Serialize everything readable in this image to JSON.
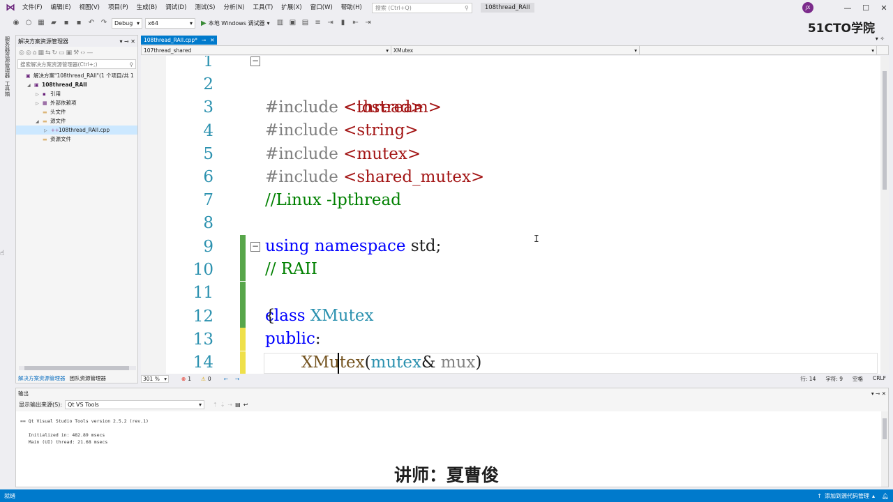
{
  "menubar": {
    "items": [
      "文件(F)",
      "编辑(E)",
      "视图(V)",
      "项目(P)",
      "生成(B)",
      "调试(D)",
      "测试(S)",
      "分析(N)",
      "工具(T)",
      "扩展(X)",
      "窗口(W)",
      "帮助(H)"
    ],
    "search_placeholder": "搜索 (Ctrl+Q)",
    "doc_title": "108thread_RAII",
    "avatar_initials": "JX",
    "minimize": "—",
    "maximize": "☐",
    "close": "✕"
  },
  "toolbar": {
    "config": "Debug",
    "platform": "x64",
    "run_label": "本地 Windows 调试器",
    "brand": "51CTO学院"
  },
  "left_strip": {
    "tab1": "服务器资源管理器",
    "tab2": "工具箱"
  },
  "solution_explorer": {
    "title": "解决方案资源管理器",
    "search_placeholder": "搜索解决方案资源管理器(Ctrl+;)",
    "tree": [
      {
        "label": "解决方案\"108thread_RAII\"(1 个项目/共 1",
        "indent": 0,
        "arrow": "",
        "icon": "solution-icon",
        "glyph": "▣"
      },
      {
        "label": "108thread_RAII",
        "indent": 1,
        "arrow": "◢",
        "icon": "project-icon",
        "glyph": "▣",
        "bold": true
      },
      {
        "label": "引用",
        "indent": 2,
        "arrow": "▷",
        "icon": "references-icon",
        "glyph": "▪"
      },
      {
        "label": "外部依赖项",
        "indent": 2,
        "arrow": "▷",
        "icon": "external-deps-icon",
        "glyph": "▦"
      },
      {
        "label": "头文件",
        "indent": 2,
        "arrow": "",
        "icon": "folder-icon",
        "glyph": "▬"
      },
      {
        "label": "源文件",
        "indent": 2,
        "arrow": "◢",
        "icon": "folder-icon",
        "glyph": "▬"
      },
      {
        "label": "108thread_RAII.cpp",
        "indent": 3,
        "arrow": "▷",
        "icon": "cpp-file-icon",
        "glyph": "++",
        "selected": true
      },
      {
        "label": "资源文件",
        "indent": 2,
        "arrow": "",
        "icon": "folder-icon",
        "glyph": "▬"
      }
    ],
    "tab_solution": "解决方案资源管理器",
    "tab_team": "团队资源管理器"
  },
  "editor": {
    "file_tab": "108thread_RAII.cpp*",
    "pin_glyph": "⊸",
    "close_glyph": "✕",
    "nav_project": "107thread_shared",
    "nav_scope": "XMutex",
    "nav_member": "",
    "lines": [
      {
        "n": "1"
      },
      {
        "n": "2"
      },
      {
        "n": "3"
      },
      {
        "n": "4"
      },
      {
        "n": "5"
      },
      {
        "n": "6"
      },
      {
        "n": "7"
      },
      {
        "n": "8"
      },
      {
        "n": "9"
      },
      {
        "n": "10"
      },
      {
        "n": "11"
      },
      {
        "n": "12"
      },
      {
        "n": "13"
      },
      {
        "n": "14"
      }
    ],
    "tokens": {
      "l1a": "#include ",
      "l1b": "<thread>",
      "l2a": "#include ",
      "l2b": "<iostream>",
      "l3a": "#include ",
      "l3b": "<string>",
      "l4a": "#include ",
      "l4b": "<mutex>",
      "l5a": "#include ",
      "l5b": "<shared_mutex>",
      "l6": "//Linux -lpthread",
      "l7a": "using",
      "l7b": " namespace",
      "l7c": " std;",
      "l8": "// RAII",
      "l9a": "class",
      "l9b": " XMutex",
      "l10": "{",
      "l11a": "public",
      "l11b": ":",
      "l12a": "XMutex",
      "l12b": "(",
      "l12c": "mutex",
      "l12d": "& ",
      "l12e": "mux",
      "l12f": ")",
      "l13": "{"
    },
    "change_colors": {
      "saved": "#57a64a",
      "unsaved": "#efe04a"
    }
  },
  "editor_status": {
    "zoom": "301 %",
    "errors": "1",
    "warnings": "0",
    "line": "行: 14",
    "col": "字符: 9",
    "spaces": "空格",
    "eol": "CRLF"
  },
  "output": {
    "title": "输出",
    "source_label": "显示输出来源(S):",
    "source_value": "Qt VS Tools",
    "lines": [
      "== Qt Visual Studio Tools version 2.5.2 (rev.1)",
      "",
      "   Initialized in: 482.89 msecs",
      "   Main (UI) thread: 21.68 msecs"
    ]
  },
  "caption": "讲师：夏曹俊",
  "statusbar": {
    "ready": "就绪",
    "source_control": "添加到源代码管理"
  }
}
